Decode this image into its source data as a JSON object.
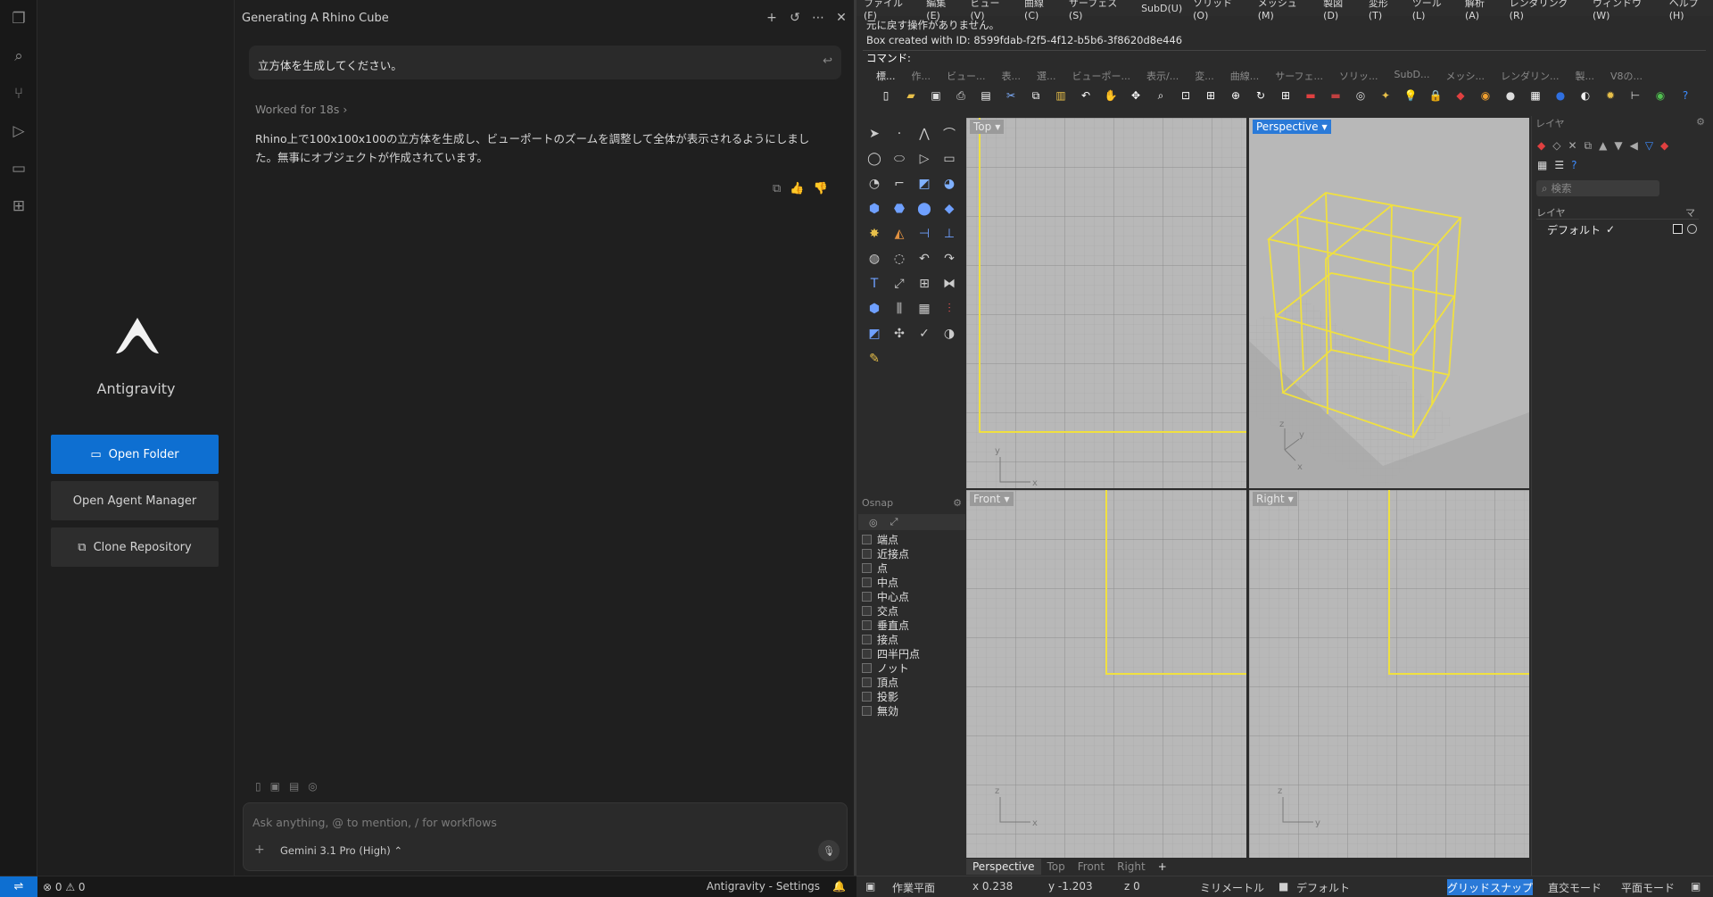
{
  "activity_bar": {
    "icons": [
      "explorer-icon",
      "search-icon",
      "source-control-icon",
      "run-debug-icon",
      "remote-icon",
      "extensions-icon"
    ]
  },
  "welcome": {
    "brand": "Antigravity",
    "open_folder": "Open Folder",
    "open_agent_manager": "Open Agent Manager",
    "clone_repository": "Clone Repository"
  },
  "chat": {
    "title": "Generating A Rhino Cube",
    "user_message": "立方体を生成してください。",
    "worked_for": "Worked for 18s",
    "reply_line1": "Rhino上で100x100x100の立方体を生成し、ビューポートのズームを調整して全体が表示されるようにしまし",
    "reply_line2": "た。無事にオブジェクトが作成されています。",
    "input_placeholder": "Ask anything, @ to mention, / for workflows",
    "model": "Gemini 3.1 Pro (High)"
  },
  "status_bar": {
    "errors": "0",
    "warnings": "0",
    "settings": "Antigravity - Settings"
  },
  "rhino": {
    "menu": [
      "ファイル(F)",
      "編集(E)",
      "ビュー(V)",
      "曲線(C)",
      "サーフェス(S)",
      "SubD(U)",
      "ソリッド(O)",
      "メッシュ(M)",
      "製図(D)",
      "変形(T)",
      "ツール(L)",
      "解析(A)",
      "レンダリング(R)",
      "ウィンドウ(W)",
      "ヘルプ(H)"
    ],
    "history_line1": "元に戻す操作がありません。",
    "history_line2": "Box created with ID: 8599fdab-f2f5-4f12-b5b6-3f8620d8e446",
    "command_prompt": "コマンド:",
    "toolbar_tabs": [
      "標...",
      "作...",
      "ビュー...",
      "表...",
      "選...",
      "ビューポー...",
      "表示/...",
      "変...",
      "曲線...",
      "サーフェ...",
      "ソリッ...",
      "SubD...",
      "メッシ...",
      "レンダリン...",
      "製...",
      "V8の..."
    ],
    "viewports": {
      "top": "Top",
      "perspective": "Perspective",
      "front": "Front",
      "right": "Right"
    },
    "axis": {
      "x": "x",
      "y": "y",
      "z": "z"
    },
    "osnap_title": "Osnap",
    "osnap_items": [
      "端点",
      "近接点",
      "点",
      "中点",
      "中心点",
      "交点",
      "垂直点",
      "接点",
      "四半円点",
      "ノット",
      "頂点",
      "投影",
      "無効"
    ],
    "viewport_tabs": [
      "Perspective",
      "Top",
      "Front",
      "Right"
    ],
    "viewport_tab_add": "+",
    "layers_title": "レイヤ",
    "layers_search": "検索",
    "layers_col": "レイヤ",
    "layers_col_m": "マ",
    "layer_default": "デフォルト",
    "status": {
      "cplane": "作業平面",
      "x": "x 0.238",
      "y": "y -1.203",
      "z": "z 0",
      "units": "ミリメートル",
      "layer": "デフォルト",
      "grid_snap": "グリッドスナップ",
      "ortho": "直交モード",
      "planar": "平面モード"
    },
    "colors": {
      "accent": "#2a7ad8",
      "object": "#f0e040",
      "viewport_bg": "#b8b8b8"
    }
  }
}
